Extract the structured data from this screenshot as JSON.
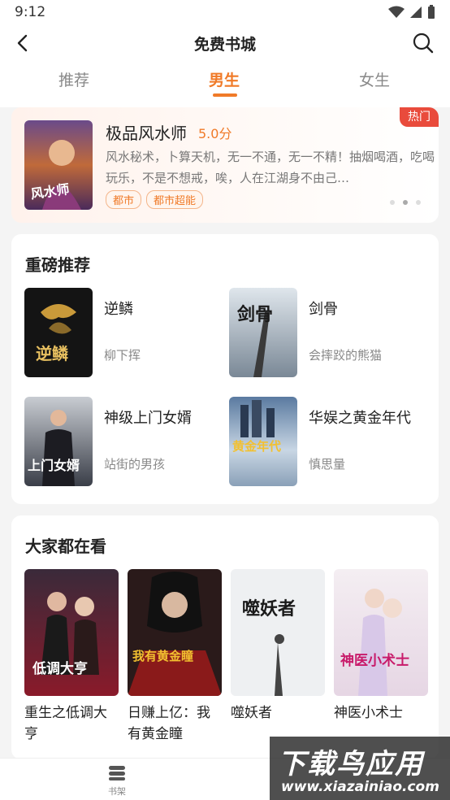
{
  "status_bar": {
    "time": "9:12"
  },
  "header": {
    "title": "免费书城"
  },
  "tabs": [
    {
      "label": "推荐"
    },
    {
      "label": "男生",
      "active": true
    },
    {
      "label": "女生"
    }
  ],
  "hot_book": {
    "badge": "热门",
    "title": "极品风水师",
    "score": "5.0分",
    "description": "风水秘术，卜算天机，无一不通，无一不精！抽烟喝酒，吃喝玩乐，不是不想戒，唉，人在江湖身不由己…",
    "tags": [
      "都市",
      "都市超能"
    ],
    "carousel_index": 2,
    "carousel_total": 3
  },
  "featured": {
    "title": "重磅推荐",
    "books": [
      {
        "name": "逆鳞",
        "author": "柳下挥",
        "cover_text": "逆鳞"
      },
      {
        "name": "剑骨",
        "author": "会摔跤的熊猫",
        "cover_text": "剑骨"
      },
      {
        "name": "神级上门女婿",
        "author": "站街的男孩",
        "cover_text": "上门女婿"
      },
      {
        "name": "华娱之黄金年代",
        "author": "慎思量",
        "cover_text": "黄金年代"
      }
    ]
  },
  "popular": {
    "title": "大家都在看",
    "books": [
      {
        "name": "重生之低调大亨",
        "cover_text": "低调大亨"
      },
      {
        "name": "日赚上亿：我有黄金瞳",
        "cover_text": "我有黄金瞳"
      },
      {
        "name": "噬妖者",
        "cover_text": "噬妖者"
      },
      {
        "name": "神医小术士",
        "cover_text": "神医小术士"
      }
    ]
  },
  "bottom_nav": {
    "shelf_label": "书架"
  },
  "watermark": {
    "big": "下载鸟应用",
    "small": "www.xiazainiao.com"
  },
  "colors": {
    "accent": "#f07a28",
    "hot_badge": "#e94b3c"
  }
}
